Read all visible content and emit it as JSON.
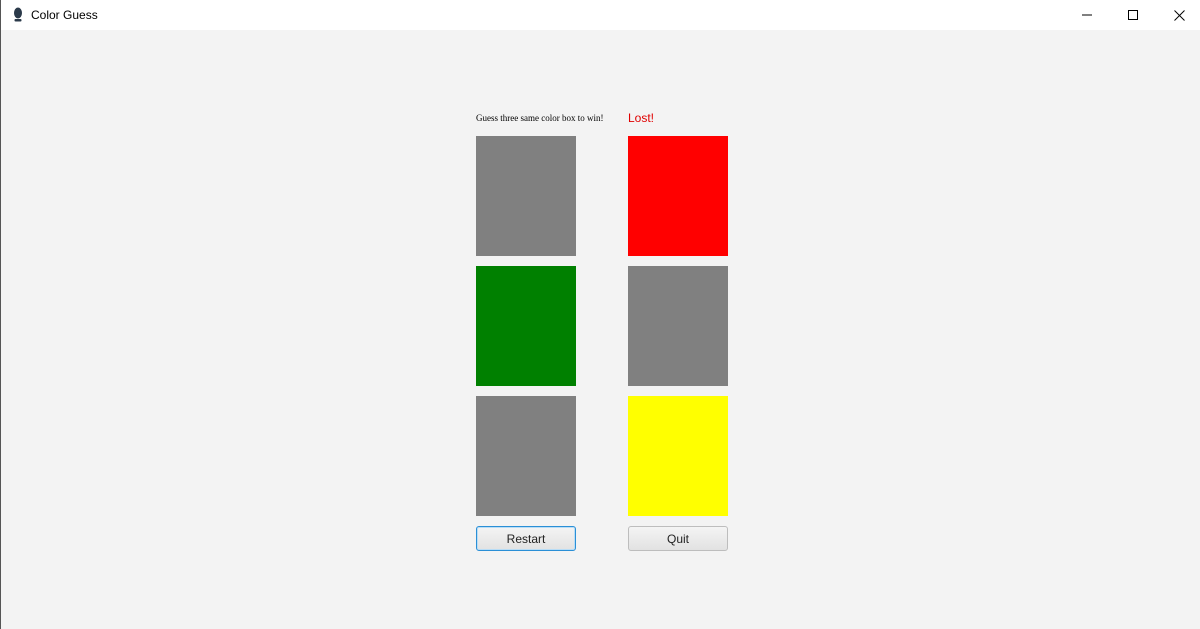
{
  "window": {
    "title": "Color Guess",
    "icon": "app-icon",
    "controls": [
      "minimize-icon",
      "maximize-icon",
      "close-icon"
    ]
  },
  "game": {
    "instruction": "Guess three same color box to win!",
    "result": "Lost!",
    "result_color": "#e00000",
    "boxes": [
      {
        "column": 1,
        "row": 1,
        "color": "#808080"
      },
      {
        "column": 2,
        "row": 1,
        "color": "#ff0000"
      },
      {
        "column": 1,
        "row": 2,
        "color": "#008000"
      },
      {
        "column": 2,
        "row": 2,
        "color": "#808080"
      },
      {
        "column": 1,
        "row": 3,
        "color": "#808080"
      },
      {
        "column": 2,
        "row": 3,
        "color": "#ffff00"
      }
    ]
  },
  "buttons": {
    "restart_label": "Restart",
    "quit_label": "Quit"
  }
}
